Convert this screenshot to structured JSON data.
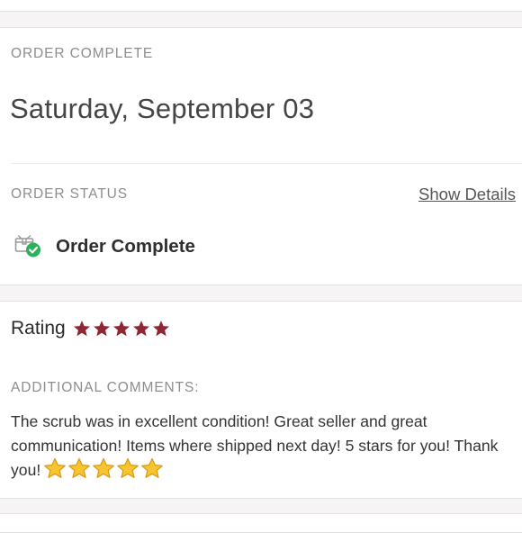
{
  "order": {
    "section_label": "ORDER COMPLETE",
    "date": "Saturday, September 03",
    "status_label": "ORDER STATUS",
    "show_details": "Show Details",
    "status": "Order Complete",
    "status_icon": "package-check-icon"
  },
  "rating": {
    "label": "Rating",
    "stars": 5,
    "max_stars": 5,
    "star_color": "#8e2633",
    "comments_label": "ADDITIONAL COMMENTS:",
    "comment": "The scrub was in excellent condition! Great seller and great communication! Items where shipped next day! 5 stars for you! Thank you!",
    "comment_emoji": "⭐⭐⭐⭐⭐"
  },
  "colors": {
    "accent_green": "#2eb05a",
    "star_maroon": "#8e2633",
    "emoji_star": "#f7c531"
  }
}
